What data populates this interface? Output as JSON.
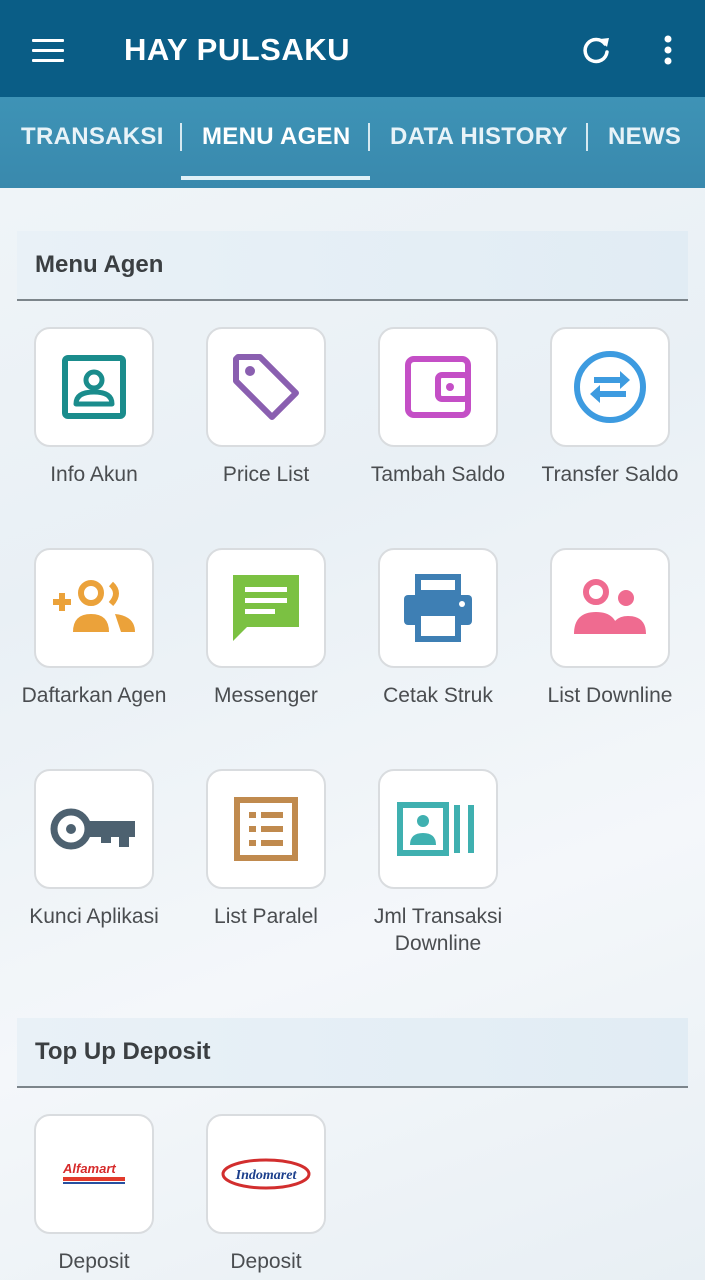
{
  "appbar": {
    "title": "HAY PULSAKU"
  },
  "tabs": [
    {
      "label": "TRANSAKSI"
    },
    {
      "label": "MENU AGEN"
    },
    {
      "label": "DATA HISTORY"
    },
    {
      "label": "NEWS"
    }
  ],
  "sections": {
    "menu_agen": {
      "title": "Menu Agen"
    },
    "top_up": {
      "title": "Top Up Deposit"
    }
  },
  "menu_items": [
    {
      "label": "Info Akun",
      "icon": "account-card-icon"
    },
    {
      "label": "Price List",
      "icon": "tag-icon"
    },
    {
      "label": "Tambah Saldo",
      "icon": "wallet-icon"
    },
    {
      "label": "Transfer Saldo",
      "icon": "transfer-icon"
    },
    {
      "label": "Daftarkan Agen",
      "icon": "add-user-icon"
    },
    {
      "label": "Messenger",
      "icon": "message-icon"
    },
    {
      "label": "Cetak Struk",
      "icon": "printer-icon"
    },
    {
      "label": "List Downline",
      "icon": "users-icon"
    },
    {
      "label": "Kunci Aplikasi",
      "icon": "key-icon"
    },
    {
      "label": "List Paralel",
      "icon": "list-icon"
    },
    {
      "label": "Jml Transaksi Downline",
      "icon": "contacts-icon"
    }
  ],
  "deposit_items": [
    {
      "label": "Deposit",
      "logo": "Alfamart"
    },
    {
      "label": "Deposit",
      "logo": "Indomaret"
    }
  ],
  "colors": {
    "appbar": "#0a5d86",
    "tabbar": "#3c8eb2",
    "teal": "#1a8c8c",
    "purple": "#8a5fb0",
    "magenta": "#c44fc6",
    "blue": "#3d9be0",
    "orange": "#eba23a",
    "green": "#7bc142",
    "steel": "#3e7fb4",
    "pink": "#ef6b90",
    "slate": "#4d6170",
    "brown": "#c08a4e",
    "cyan": "#3fb0b0"
  }
}
